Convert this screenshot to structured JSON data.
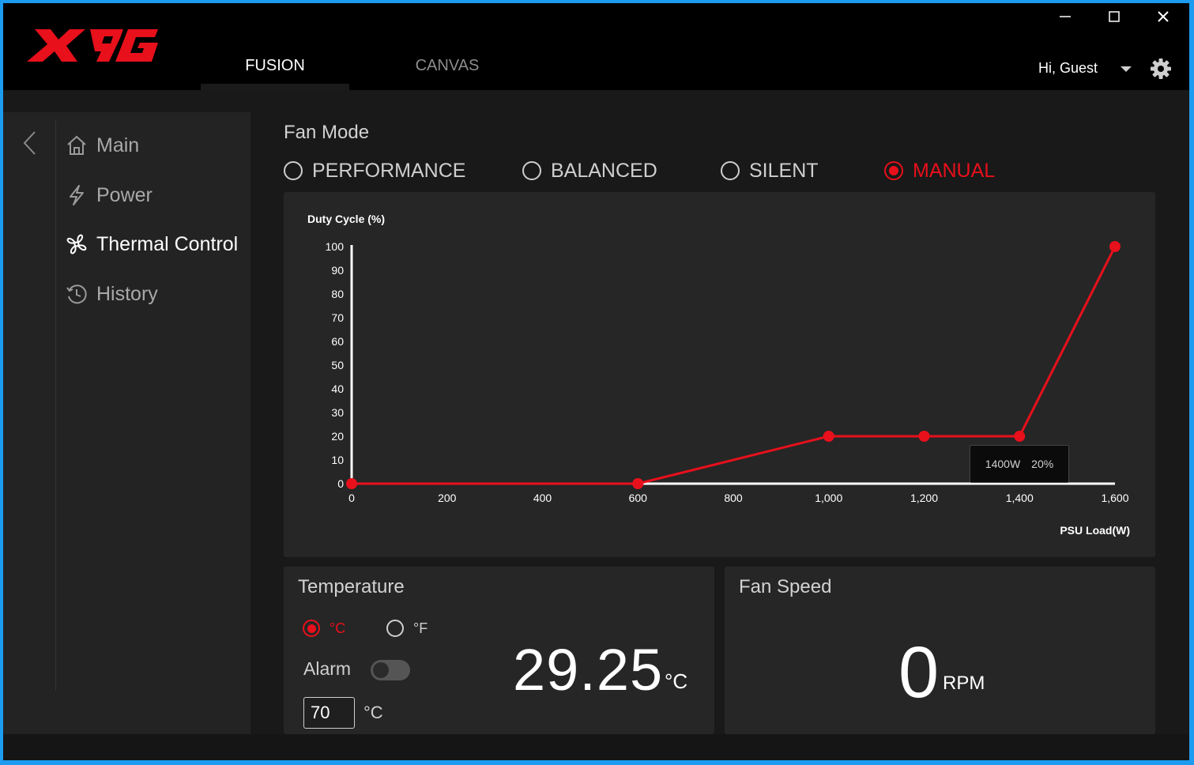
{
  "header": {
    "brand": "XPG",
    "tabs": [
      {
        "label": "FUSION",
        "active": true
      },
      {
        "label": "CANVAS",
        "active": false
      }
    ],
    "greeting": "Hi, Guest",
    "window_controls": [
      "minimize-icon",
      "maximize-icon",
      "close-icon"
    ]
  },
  "sidebar": {
    "items": [
      {
        "label": "Main",
        "icon": "home-icon",
        "active": false
      },
      {
        "label": "Power",
        "icon": "lightning-icon",
        "active": false
      },
      {
        "label": "Thermal Control",
        "icon": "fan-icon",
        "active": true
      },
      {
        "label": "History",
        "icon": "history-icon",
        "active": false
      }
    ]
  },
  "fan_mode": {
    "title": "Fan Mode",
    "options": [
      {
        "label": "PERFORMANCE",
        "selected": false
      },
      {
        "label": "BALANCED",
        "selected": false
      },
      {
        "label": "SILENT",
        "selected": false
      },
      {
        "label": "MANUAL",
        "selected": true
      }
    ]
  },
  "chart_data": {
    "type": "line",
    "ylabel": "Duty Cycle (%)",
    "xlabel": "PSU Load(W)",
    "xlim": [
      0,
      1600
    ],
    "ylim": [
      0,
      100
    ],
    "x_ticks": [
      "0",
      "200",
      "400",
      "600",
      "800",
      "1,000",
      "1,200",
      "1,400",
      "1,600"
    ],
    "y_ticks": [
      "0",
      "10",
      "20",
      "30",
      "40",
      "50",
      "60",
      "70",
      "80",
      "90",
      "100"
    ],
    "points": [
      {
        "x": 0,
        "y": 0
      },
      {
        "x": 600,
        "y": 0
      },
      {
        "x": 1000,
        "y": 20
      },
      {
        "x": 1200,
        "y": 20
      },
      {
        "x": 1400,
        "y": 20
      },
      {
        "x": 1600,
        "y": 100
      }
    ],
    "line_color": "#e8101b",
    "tooltip": {
      "load": "1400W",
      "duty": "20%"
    }
  },
  "temperature": {
    "title": "Temperature",
    "unit_options": [
      {
        "label": "°C",
        "selected": true
      },
      {
        "label": "°F",
        "selected": false
      }
    ],
    "alarm_label": "Alarm",
    "alarm_enabled": false,
    "alarm_value": "70",
    "alarm_unit": "°C",
    "value": "29.25",
    "unit": "°C"
  },
  "fan_speed": {
    "title": "Fan Speed",
    "value": "0",
    "unit": "RPM"
  },
  "colors": {
    "accent": "#e8101b",
    "background": "#191919",
    "panel": "#262626"
  }
}
